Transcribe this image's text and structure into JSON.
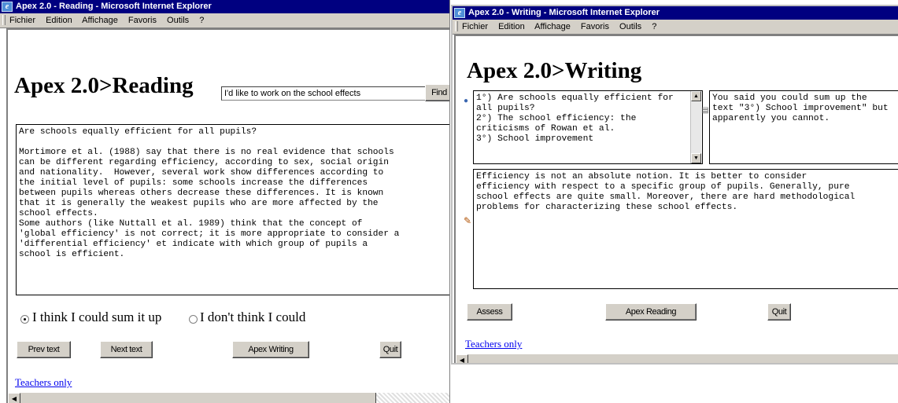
{
  "reading_window": {
    "title": "Apex 2.0 - Reading - Microsoft Internet Explorer",
    "menu": [
      "Fichier",
      "Edition",
      "Affichage",
      "Favoris",
      "Outils",
      "?"
    ],
    "heading": "Apex 2.0>Reading",
    "search_value": "I'd like to work on the school effects",
    "find_label": "Find",
    "text": "Are schools equally efficient for all pupils?\n\nMortimore et al. (1988) say that there is no real evidence that schools\ncan be different regarding efficiency, according to sex, social origin\nand nationality.  However, several work show differences according to\nthe initial level of pupils: some schools increase the differences\nbetween pupils whereas others decrease these differences. It is known\nthat it is generally the weakest pupils who are more affected by the\nschool effects.\nSome authors (like Nuttall et al. 1989) think that the concept of\n'global efficiency' is not correct; it is more appropriate to consider a\n'differential efficiency' et indicate with which group of pupils a\nschool is efficient.",
    "radio_could": "I think I could sum it up",
    "radio_couldnt": "I don't think I could",
    "prev_label": "Prev text",
    "next_label": "Next text",
    "writing_label": "Apex Writing",
    "quit_label": "Quit",
    "teachers_link": "Teachers only",
    "scroll_left": "◀"
  },
  "writing_window": {
    "title": "Apex 2.0 - Writing - Microsoft Internet Explorer",
    "menu": [
      "Fichier",
      "Edition",
      "Affichage",
      "Favoris",
      "Outils",
      "?"
    ],
    "heading": "Apex 2.0>Writing",
    "outline_text": "1°) Are schools equally efficient for\nall pupils?\n2°) The school efficiency: the\ncriticisms of Rowan et al.\n3°) School improvement",
    "feedback_text": "You said you could sum up the\ntext \"3°) School improvement\" but\napparently you cannot.",
    "essay_text": "Efficiency is not an absolute notion. It is better to consider\nefficiency with respect to a specific group of pupils. Generally, pure\nschool effects are quite small. Moreover, there are hard methodological\nproblems for characterizing these school effects.",
    "assess_label": "Assess",
    "reading_label": "Apex Reading",
    "quit_label": "Quit",
    "teachers_link": "Teachers only",
    "scroll_left": "◀"
  },
  "icons": {
    "scroll_up": "▲",
    "scroll_down": "▼",
    "info": "●",
    "doc": "▤",
    "pencil": "✎"
  }
}
